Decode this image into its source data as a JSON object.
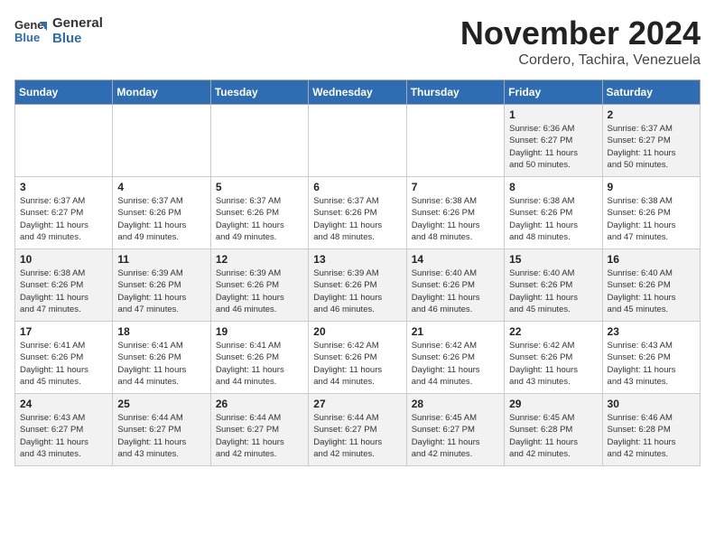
{
  "logo": {
    "line1": "General",
    "line2": "Blue"
  },
  "title": "November 2024",
  "subtitle": "Cordero, Tachira, Venezuela",
  "days_of_week": [
    "Sunday",
    "Monday",
    "Tuesday",
    "Wednesday",
    "Thursday",
    "Friday",
    "Saturday"
  ],
  "weeks": [
    [
      {
        "day": "",
        "info": ""
      },
      {
        "day": "",
        "info": ""
      },
      {
        "day": "",
        "info": ""
      },
      {
        "day": "",
        "info": ""
      },
      {
        "day": "",
        "info": ""
      },
      {
        "day": "1",
        "info": "Sunrise: 6:36 AM\nSunset: 6:27 PM\nDaylight: 11 hours\nand 50 minutes."
      },
      {
        "day": "2",
        "info": "Sunrise: 6:37 AM\nSunset: 6:27 PM\nDaylight: 11 hours\nand 50 minutes."
      }
    ],
    [
      {
        "day": "3",
        "info": "Sunrise: 6:37 AM\nSunset: 6:27 PM\nDaylight: 11 hours\nand 49 minutes."
      },
      {
        "day": "4",
        "info": "Sunrise: 6:37 AM\nSunset: 6:26 PM\nDaylight: 11 hours\nand 49 minutes."
      },
      {
        "day": "5",
        "info": "Sunrise: 6:37 AM\nSunset: 6:26 PM\nDaylight: 11 hours\nand 49 minutes."
      },
      {
        "day": "6",
        "info": "Sunrise: 6:37 AM\nSunset: 6:26 PM\nDaylight: 11 hours\nand 48 minutes."
      },
      {
        "day": "7",
        "info": "Sunrise: 6:38 AM\nSunset: 6:26 PM\nDaylight: 11 hours\nand 48 minutes."
      },
      {
        "day": "8",
        "info": "Sunrise: 6:38 AM\nSunset: 6:26 PM\nDaylight: 11 hours\nand 48 minutes."
      },
      {
        "day": "9",
        "info": "Sunrise: 6:38 AM\nSunset: 6:26 PM\nDaylight: 11 hours\nand 47 minutes."
      }
    ],
    [
      {
        "day": "10",
        "info": "Sunrise: 6:38 AM\nSunset: 6:26 PM\nDaylight: 11 hours\nand 47 minutes."
      },
      {
        "day": "11",
        "info": "Sunrise: 6:39 AM\nSunset: 6:26 PM\nDaylight: 11 hours\nand 47 minutes."
      },
      {
        "day": "12",
        "info": "Sunrise: 6:39 AM\nSunset: 6:26 PM\nDaylight: 11 hours\nand 46 minutes."
      },
      {
        "day": "13",
        "info": "Sunrise: 6:39 AM\nSunset: 6:26 PM\nDaylight: 11 hours\nand 46 minutes."
      },
      {
        "day": "14",
        "info": "Sunrise: 6:40 AM\nSunset: 6:26 PM\nDaylight: 11 hours\nand 46 minutes."
      },
      {
        "day": "15",
        "info": "Sunrise: 6:40 AM\nSunset: 6:26 PM\nDaylight: 11 hours\nand 45 minutes."
      },
      {
        "day": "16",
        "info": "Sunrise: 6:40 AM\nSunset: 6:26 PM\nDaylight: 11 hours\nand 45 minutes."
      }
    ],
    [
      {
        "day": "17",
        "info": "Sunrise: 6:41 AM\nSunset: 6:26 PM\nDaylight: 11 hours\nand 45 minutes."
      },
      {
        "day": "18",
        "info": "Sunrise: 6:41 AM\nSunset: 6:26 PM\nDaylight: 11 hours\nand 44 minutes."
      },
      {
        "day": "19",
        "info": "Sunrise: 6:41 AM\nSunset: 6:26 PM\nDaylight: 11 hours\nand 44 minutes."
      },
      {
        "day": "20",
        "info": "Sunrise: 6:42 AM\nSunset: 6:26 PM\nDaylight: 11 hours\nand 44 minutes."
      },
      {
        "day": "21",
        "info": "Sunrise: 6:42 AM\nSunset: 6:26 PM\nDaylight: 11 hours\nand 44 minutes."
      },
      {
        "day": "22",
        "info": "Sunrise: 6:42 AM\nSunset: 6:26 PM\nDaylight: 11 hours\nand 43 minutes."
      },
      {
        "day": "23",
        "info": "Sunrise: 6:43 AM\nSunset: 6:26 PM\nDaylight: 11 hours\nand 43 minutes."
      }
    ],
    [
      {
        "day": "24",
        "info": "Sunrise: 6:43 AM\nSunset: 6:27 PM\nDaylight: 11 hours\nand 43 minutes."
      },
      {
        "day": "25",
        "info": "Sunrise: 6:44 AM\nSunset: 6:27 PM\nDaylight: 11 hours\nand 43 minutes."
      },
      {
        "day": "26",
        "info": "Sunrise: 6:44 AM\nSunset: 6:27 PM\nDaylight: 11 hours\nand 42 minutes."
      },
      {
        "day": "27",
        "info": "Sunrise: 6:44 AM\nSunset: 6:27 PM\nDaylight: 11 hours\nand 42 minutes."
      },
      {
        "day": "28",
        "info": "Sunrise: 6:45 AM\nSunset: 6:27 PM\nDaylight: 11 hours\nand 42 minutes."
      },
      {
        "day": "29",
        "info": "Sunrise: 6:45 AM\nSunset: 6:28 PM\nDaylight: 11 hours\nand 42 minutes."
      },
      {
        "day": "30",
        "info": "Sunrise: 6:46 AM\nSunset: 6:28 PM\nDaylight: 11 hours\nand 42 minutes."
      }
    ]
  ]
}
